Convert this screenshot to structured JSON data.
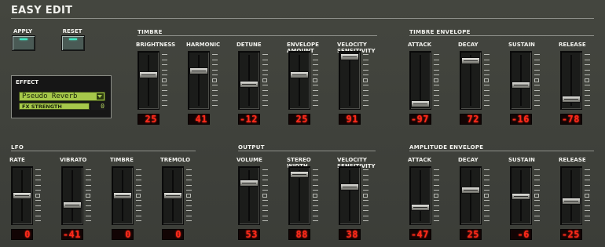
{
  "title": "EASY EDIT",
  "buttons": {
    "apply": "APPLY",
    "reset": "RESET"
  },
  "effect": {
    "title": "EFFECT",
    "selected": "Pseudo Reverb",
    "strength_label": "FX STRENGTH",
    "strength_value": "0"
  },
  "sections": {
    "timbre": "TIMBRE",
    "timbre_envelope": "TIMBRE ENVELOPE",
    "lfo": "LFO",
    "output": "OUTPUT",
    "amplitude_envelope": "AMPLITUDE ENVELOPE"
  },
  "sliders": [
    {
      "label": "BRIGHTNESS",
      "display": "25",
      "level": 0.62
    },
    {
      "label": "HARMONIC",
      "display": "41",
      "level": 0.7
    },
    {
      "label": "DETUNE",
      "display": "-12",
      "level": 0.42
    },
    {
      "label": "ENVELOPE AMOUNT",
      "display": "25",
      "level": 0.62
    },
    {
      "label": "VELOCITY SENSITIVITY",
      "display": "91",
      "level": 0.98
    },
    {
      "label": "ATTACK",
      "display": "-97",
      "level": 0.02
    },
    {
      "label": "DECAY",
      "display": "72",
      "level": 0.9
    },
    {
      "label": "SUSTAIN",
      "display": "-16",
      "level": 0.4
    },
    {
      "label": "RELEASE",
      "display": "-78",
      "level": 0.12
    },
    {
      "label": "RATE",
      "display": "0",
      "level": 0.5
    },
    {
      "label": "VIBRATO",
      "display": "-41",
      "level": 0.3
    },
    {
      "label": "TIMBRE",
      "display": "0",
      "level": 0.5
    },
    {
      "label": "TREMOLO",
      "display": "0",
      "level": 0.5
    },
    {
      "label": "VOLUME",
      "display": "53",
      "level": 0.76
    },
    {
      "label": "STEREO WIDTH",
      "display": "88",
      "level": 0.94
    },
    {
      "label": "VELOCITY SENSITIVITY",
      "display": "38",
      "level": 0.68
    },
    {
      "label": "ATTACK",
      "display": "-47",
      "level": 0.26
    },
    {
      "label": "DECAY",
      "display": "25",
      "level": 0.62
    },
    {
      "label": "SUSTAIN",
      "display": "-6",
      "level": 0.48
    },
    {
      "label": "RELEASE",
      "display": "-25",
      "level": 0.38
    }
  ]
}
